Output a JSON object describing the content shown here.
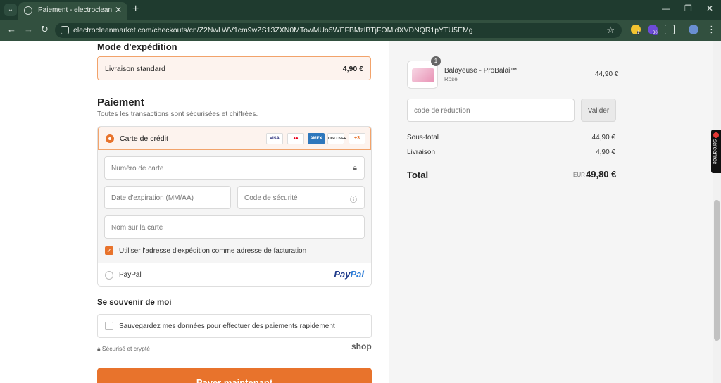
{
  "browser": {
    "tab_title": "Paiement - electroclean",
    "url": "electrocleanmarket.com/checkouts/cn/Z2NwLWV1cm9wZS13ZXN0MTowMUo5WEFBMzlBTjFOMldXVDNQR1pYTU5EMg",
    "extension_badge": "30",
    "ext_small_badge": "1"
  },
  "shipping": {
    "heading": "Mode d'expédition",
    "option_label": "Livraison standard",
    "option_price": "4,90 €"
  },
  "payment": {
    "heading": "Paiement",
    "subtitle": "Toutes les transactions sont sécurisées et chiffrées.",
    "credit_card_label": "Carte de crédit",
    "card_logos": [
      "VISA",
      "MC",
      "AMEX",
      "DISCOVER",
      "+3"
    ],
    "card_number_placeholder": "Numéro de carte",
    "expiry_placeholder": "Date d'expiration (MM/AA)",
    "cvv_placeholder": "Code de sécurité",
    "name_placeholder": "Nom sur la carte",
    "billing_same_label": "Utiliser l'adresse d'expédition comme adresse de facturation",
    "paypal_label": "PayPal",
    "paypal_logo_a": "Pay",
    "paypal_logo_b": "Pal"
  },
  "remember": {
    "heading": "Se souvenir de moi",
    "checkbox_label": "Sauvegardez mes données pour effectuer des paiements rapidement"
  },
  "footer": {
    "secure_note": "Sécurisé et crypté",
    "shop_logo": "shop",
    "pay_button": "Payer maintenant"
  },
  "summary": {
    "product_name": "Balayeuse - ProBalai™",
    "product_variant": "Rose",
    "product_qty": "1",
    "product_price": "44,90 €",
    "discount_placeholder": "code de réduction",
    "validate_button": "Valider",
    "subtotal_label": "Sous-total",
    "subtotal_value": "44,90 €",
    "delivery_label": "Livraison",
    "delivery_value": "4,90 €",
    "total_label": "Total",
    "total_currency": "EUR",
    "total_value": "49,80 €"
  },
  "screenrec": {
    "label": "screenrec"
  },
  "colors": {
    "accent": "#e8732c",
    "chrome": "#32503f"
  }
}
